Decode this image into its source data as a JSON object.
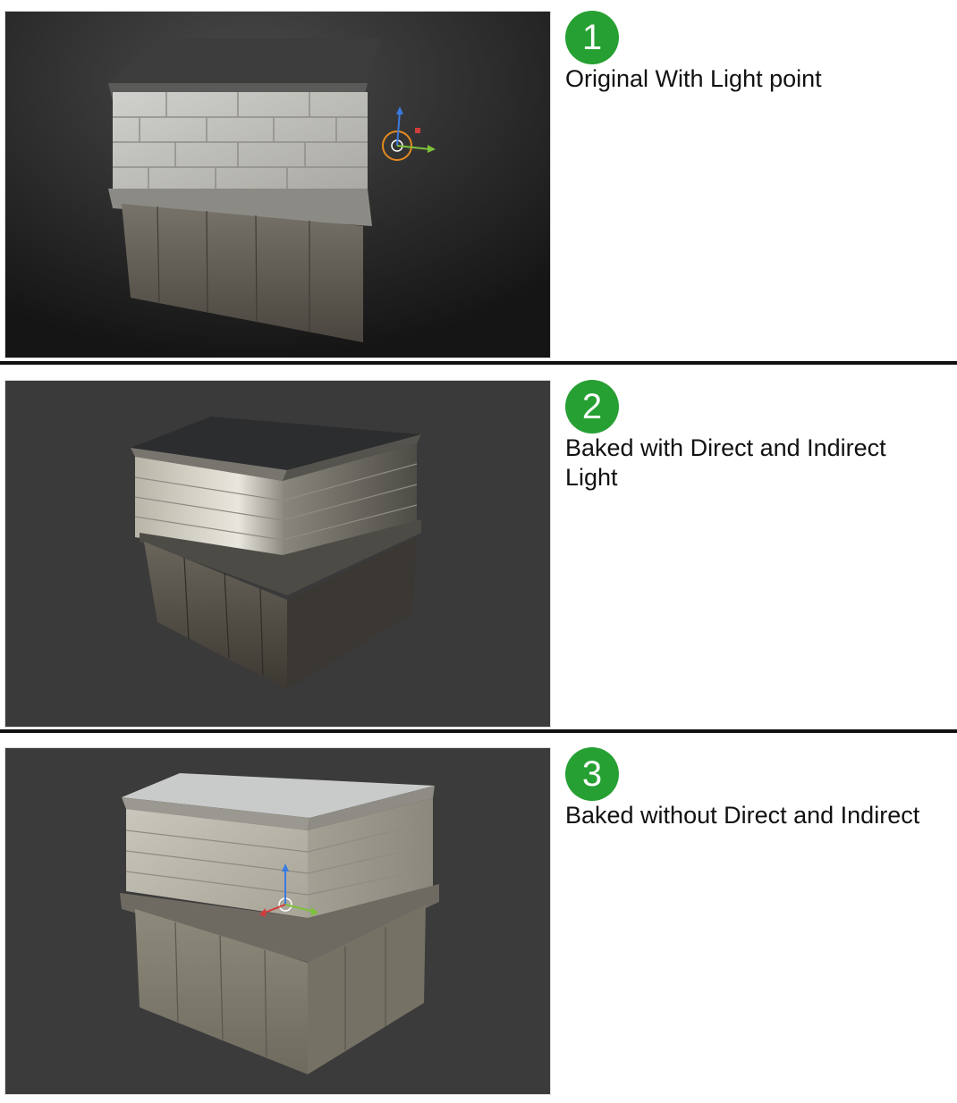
{
  "steps": [
    {
      "number": "1",
      "caption": "Original With Light point",
      "viewport_bg": "#2f2f2f"
    },
    {
      "number": "2",
      "caption": "Baked with Direct and Indirect Light",
      "viewport_bg": "#3a3a3a"
    },
    {
      "number": "3",
      "caption": "Baked without Direct and Indirect",
      "viewport_bg": "#3b3b3b"
    }
  ],
  "colors": {
    "badge": "#27a033",
    "divider": "#111111"
  },
  "icons": {
    "light_gizmo": "light-point-icon",
    "transform_gizmo": "transform-gizmo-icon"
  }
}
